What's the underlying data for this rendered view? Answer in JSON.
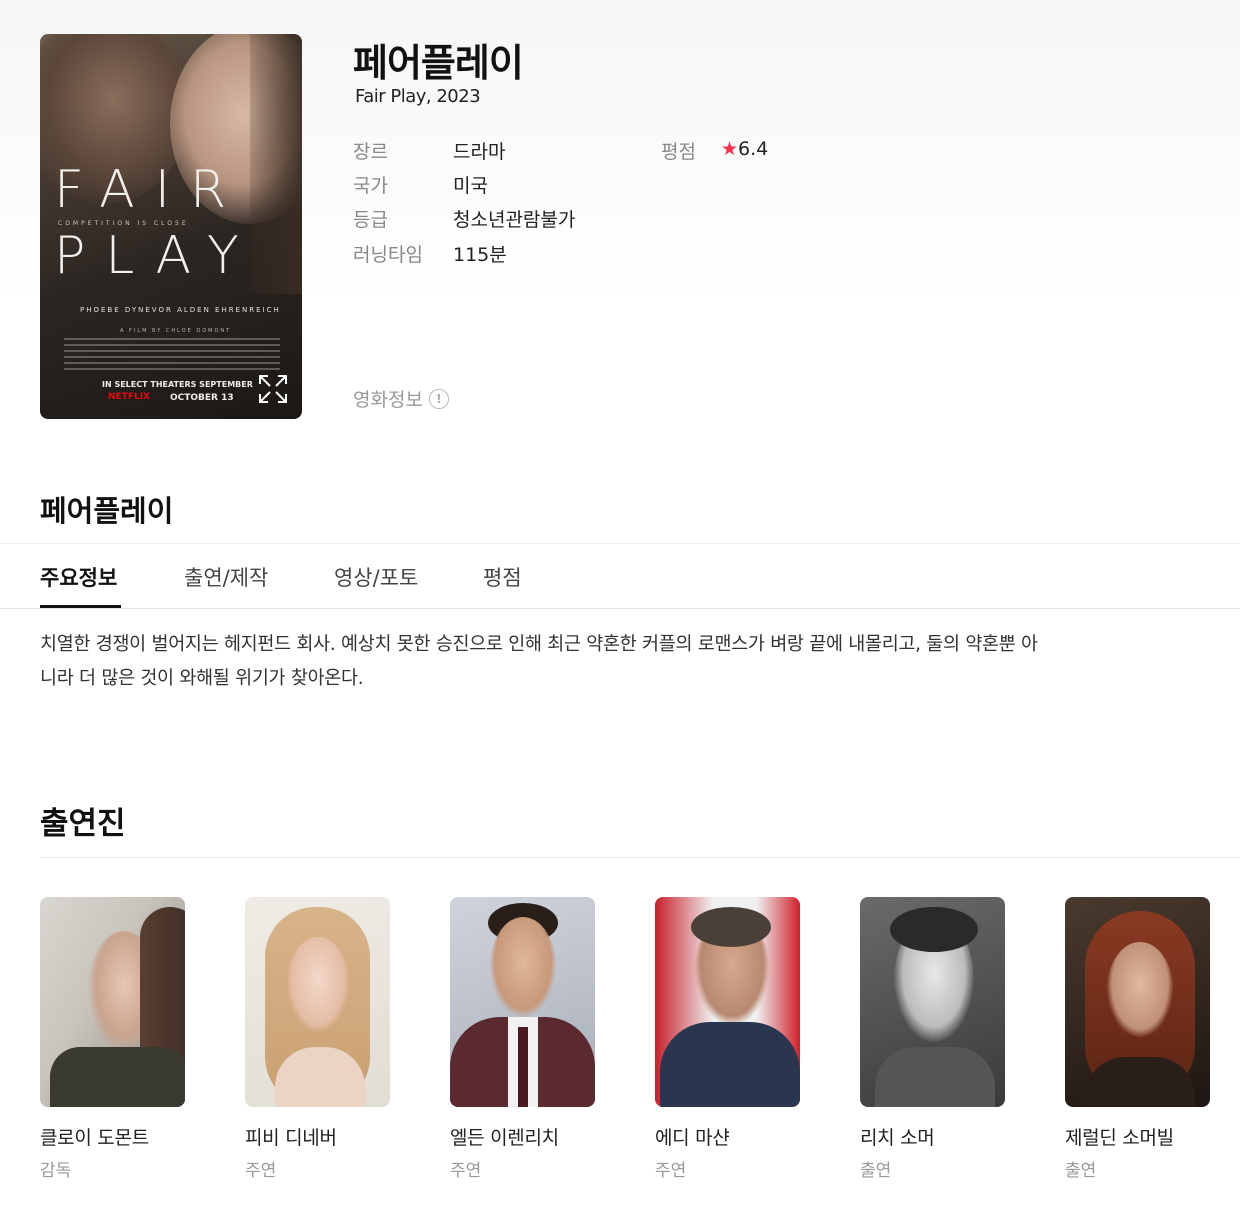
{
  "movie": {
    "title": "페어플레이",
    "original_title_year": "Fair Play, 2023",
    "poster": {
      "title_line1": "FAIR",
      "title_line2": "PLAY",
      "tagline": "COMPETITION IS CLOSE",
      "cast_names": "PHOEBE DYNEVOR  ALDEN EHRENREICH",
      "director_credit": "A FILM BY CHLOE DOMONT",
      "release": "IN SELECT THEATERS SEPTEMBER",
      "network": "NETFLIX",
      "date": "OCTOBER 13"
    },
    "info": {
      "genre_label": "장르",
      "genre": "드라마",
      "country_label": "국가",
      "country": "미국",
      "rating_label": "등급",
      "rating": "청소년관람불가",
      "runtime_label": "러닝타임",
      "runtime": "115분",
      "score_label": "평점",
      "score_star": "★",
      "score": "6.4"
    },
    "movie_info_link": "영화정보",
    "info_icon": "!"
  },
  "section_title": "페어플레이",
  "tabs": [
    {
      "label": "주요정보",
      "active": true
    },
    {
      "label": "출연/제작",
      "active": false
    },
    {
      "label": "영상/포토",
      "active": false
    },
    {
      "label": "평점",
      "active": false
    }
  ],
  "synopsis": "치열한 경쟁이 벌어지는 헤지펀드 회사. 예상치 못한 승진으로 인해 최근 약혼한 커플의 로맨스가 벼랑 끝에 내몰리고, 둘의 약혼뿐 아니라 더 많은 것이 와해될 위기가 찾아온다.",
  "cast_section_title": "출연진",
  "cast": [
    {
      "name": "클로이 도몬트",
      "role": "감독"
    },
    {
      "name": "피비 디네버",
      "role": "주연"
    },
    {
      "name": "엘든 이렌리치",
      "role": "주연"
    },
    {
      "name": "에디 마샨",
      "role": "주연"
    },
    {
      "name": "리치 소머",
      "role": "출연"
    },
    {
      "name": "제럴딘 소머빌",
      "role": "출연"
    }
  ],
  "colors": {
    "star": "#ff2f4f",
    "netflix": "#e50914",
    "label": "#888888",
    "text": "#222222"
  }
}
